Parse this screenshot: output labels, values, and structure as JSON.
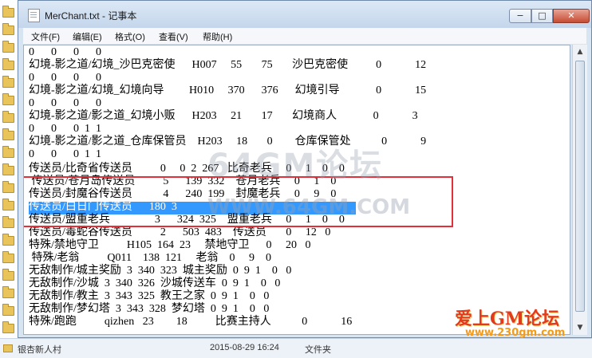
{
  "window": {
    "title": "MerChant.txt - 记事本",
    "controls": {
      "minimize": "−",
      "maximize": "□",
      "close": "✕"
    }
  },
  "menu": [
    "文件(F)",
    "编辑(E)",
    "格式(O)",
    "查看(V)",
    "帮助(H)"
  ],
  "editor_lines": [
    "0      0      0      0",
    "幻境-影之道/幻境_沙巴克密使      H007     55       75       沙巴克密使          0            12",
    "0      0      0      0",
    "幻境-影之道/幻境_幻境向导         H010     370      376      幻境引导             0            15",
    "0      0      0      0",
    "幻境-影之道/影之道_幻境小贩      H203     21       17       幻境商人             0            3",
    "0      0      0  1  1",
    "幻境-影之道/影之道_仓库保管员    H203     18       0        仓库保管处           0            9",
    "0      0      0  1  1",
    "传送员/比奇省传送员          0     0  2  267   比奇老兵     0     1    0    0",
    " 传送员/苍月岛传送员          5      139  332    苍月老兵     0     1    0",
    "传送员/封魔谷传送员           4      240  199    封魔老兵     0     9    0",
    "传送员/白日门传送员      180  3",
    "传送员/盟重老兵                3      324  325    盟重老兵     0     1    0    0",
    "传送员/毒蛇谷传送员          2      503  483    传送员       0     12   0",
    "特殊/禁地守卫          H105  164  23     禁地守卫      0     20   0",
    " 特殊/老翁          Q011    138  121     老翁    0     9    0",
    "无敌制作/城主奖励  3  340  323  城主奖励  0  9  1    0   0",
    "无敌制作/沙城  3  340  326  沙城传送车  0  9  1    0   0",
    "无敌制作/教主  3  343  325  教王之家  0  9  1    0   0",
    "无敌制作/梦幻塔  3  343  328  梦幻塔  0  9  1    0   0",
    "特殊/跑跑          qizhen   23        18          比赛主持人           0            16"
  ],
  "watermark": {
    "text1": "64GM论坛",
    "text2": "WWW.64GM.COM"
  },
  "logo": {
    "text": "爱上GM论坛",
    "url": "www.230gm.com"
  },
  "statusbar": {
    "folder": "银杏新人村",
    "date": "2015-08-29 16:24",
    "type": "文件夹"
  },
  "colors": {
    "selection": "#3399ff",
    "highlight_box": "#e2303a",
    "folder": "#e9c45a"
  }
}
